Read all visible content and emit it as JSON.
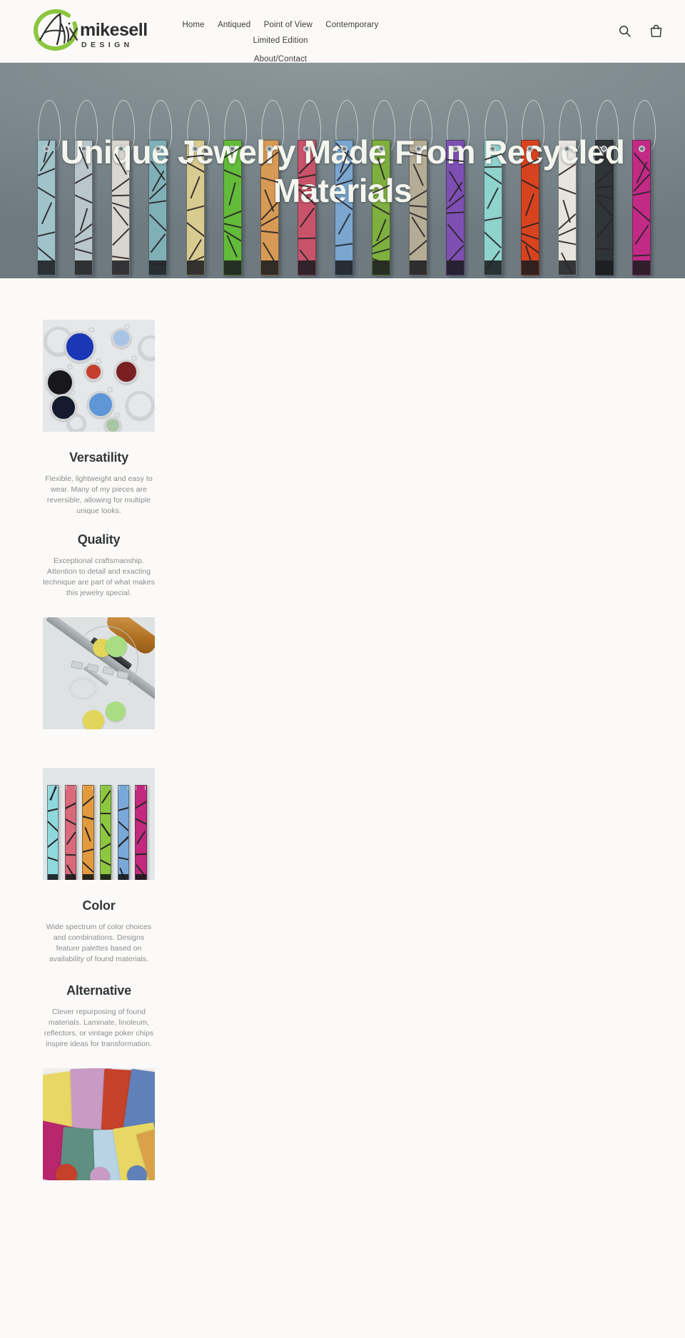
{
  "site": {
    "brand_name": "mikesell",
    "brand_script": "Alix",
    "brand_sub": "D E S I G N",
    "background": "#fbfaf8",
    "accent_green": "#8cc63f",
    "text_dark": "#33373a",
    "text_muted": "#8c8d8f"
  },
  "header": {
    "nav": [
      {
        "label": "Home"
      },
      {
        "label": "Antiqued"
      },
      {
        "label": "Point of View"
      },
      {
        "label": "Contemporary"
      },
      {
        "label": "Limited Edition"
      }
    ],
    "nav_row2": [
      {
        "label": "About/Contact"
      }
    ],
    "actions": [
      {
        "name": "search-icon",
        "label": "Search"
      },
      {
        "name": "cart-icon",
        "label": "Cart"
      }
    ]
  },
  "hero": {
    "heading": "Unique Jewelry Made From Recycled Materials",
    "background_color": "#7f8a8d",
    "pendant_colors": [
      "#9fc3c9",
      "#b9c6cb",
      "#d8d6cf",
      "#7fb0b6",
      "#d8cb90",
      "#63bb3a",
      "#d79a55",
      "#c9536a",
      "#7aa6cf",
      "#7fb03f",
      "#b5ac96",
      "#7e4fb3",
      "#8fd3cd",
      "#d8431f",
      "#e7e4df",
      "#2f3438",
      "#c32a86"
    ]
  },
  "features": [
    {
      "id": "versatility",
      "title": "Versatility",
      "body": "Flexible, lightweight and easy to wear. Many of my pieces are reversible, allowing for multiple unique looks.",
      "image_alt": "round-bezel-pendants-photo",
      "image_position": "above"
    },
    {
      "id": "quality",
      "title": "Quality",
      "body": "Exceptional craftsmanship. Attention to detail and exacting technique are part of what makes this jewelry special.",
      "image_alt": "jewelry-tools-photo",
      "image_position": "below"
    },
    {
      "id": "color",
      "title": "Color",
      "body": "Wide spectrum of color choices and combinations. Designs feature palettes based on availability of found materials.",
      "image_alt": "color-strip-pendants-photo",
      "image_position": "above"
    },
    {
      "id": "alternative",
      "title": "Alternative",
      "body": "Clever repurposing of found materials. Laminate, linoleum, reflectors, or vintage poker chips inspire ideas for transformation.",
      "image_alt": "linoleum-sheets-photo",
      "image_position": "below"
    }
  ],
  "photo_palettes": {
    "bezels": [
      "#1b37b5",
      "#a7c4e6",
      "#18181a",
      "#7a1f22",
      "#151a2e",
      "#5e96d6",
      "#a8c6a4",
      "#c4402b"
    ],
    "tools": [
      "#e2d65a",
      "#a8dd84",
      "#b07022"
    ],
    "strips": [
      "#8fd9dd",
      "#d9697b",
      "#e39a3e",
      "#8dc63f",
      "#79a8d8",
      "#c2297e"
    ],
    "sheets": [
      "#e8d765",
      "#c79bc4",
      "#c6412a",
      "#5f80b8",
      "#b8266e",
      "#5f8f81",
      "#b8d4e4",
      "#d9a24a"
    ]
  }
}
